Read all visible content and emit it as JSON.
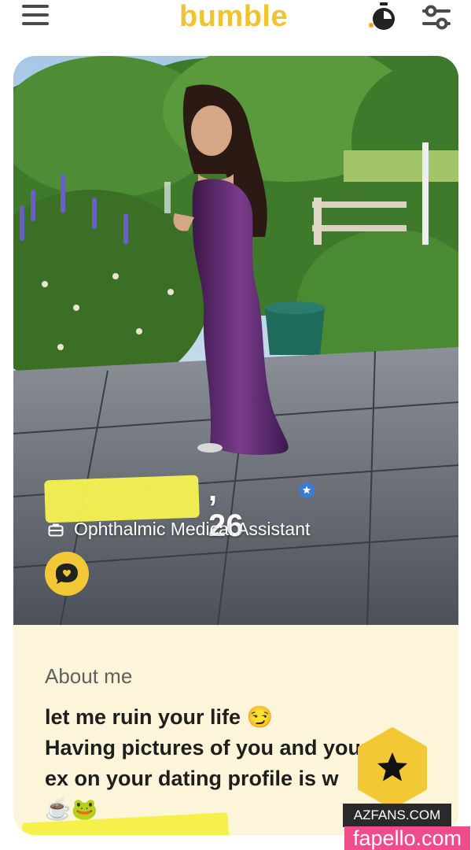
{
  "header": {
    "logo_text": "bumble",
    "menu_icon": "hamburger-menu-icon",
    "timer_icon": "stopwatch-icon",
    "filter_icon": "filter-sliders-icon",
    "accent_color": "#f0c430"
  },
  "profile": {
    "age": ", 26",
    "verified_icon": "verified-badge-icon",
    "job_icon": "briefcase-icon",
    "job_title": "Ophthalmic Medical Assistant",
    "chat_icon": "compliment-chat-icon"
  },
  "about": {
    "title": "About me",
    "bio_line1": "let me ruin your life 😏",
    "bio_line2": "Having pictures of you and your",
    "bio_line3": "ex on your dating profile is w",
    "bio_line4": "☕🐸",
    "background_color": "#fdf5da"
  },
  "actions": {
    "superswipe_icon": "star-icon"
  },
  "watermarks": {
    "site1": "AZFANS.COM",
    "site2": "fapello.com"
  }
}
